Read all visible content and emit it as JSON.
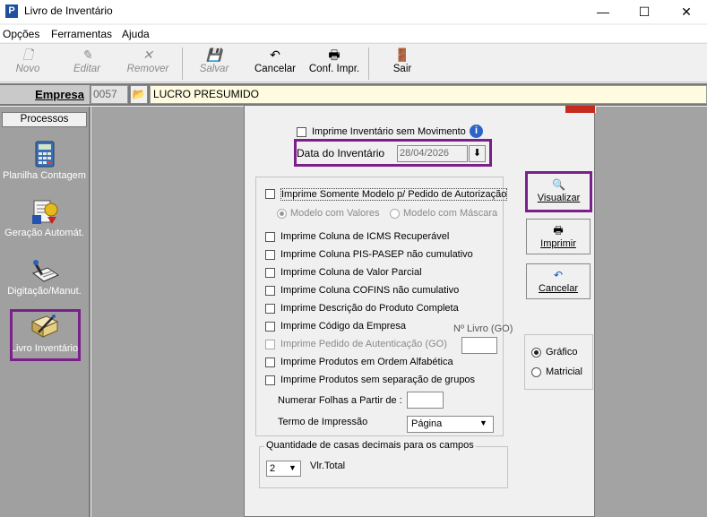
{
  "window": {
    "title": "Livro de Inventário",
    "icon_letter": "P",
    "controls": [
      "—",
      "☐",
      "✕"
    ]
  },
  "menu": [
    "Opções",
    "Ferramentas",
    "Ajuda"
  ],
  "toolbar": {
    "novo": "Novo",
    "editar": "Editar",
    "remover": "Remover",
    "salvar": "Salvar",
    "cancelar": "Cancelar",
    "conf_impr": "Conf. Impr.",
    "sair": "Sair"
  },
  "empresa": {
    "label": "Empresa",
    "code": "0057",
    "name": "LUCRO PRESUMIDO"
  },
  "sidebar": {
    "header": "Processos",
    "items": [
      {
        "label": "Planilha Contagem",
        "icon": "calculator-icon"
      },
      {
        "label": "Geração Automát.",
        "icon": "automation-icon"
      },
      {
        "label": "Digitação/Manut.",
        "icon": "typing-icon"
      },
      {
        "label": "Livro Inventário",
        "icon": "book-icon"
      }
    ]
  },
  "dialog": {
    "sem_movimento": "Imprime Inventário sem Movimento",
    "data_label": "Data do Inventário",
    "data_value": "28/04/2026",
    "modelo_pedido": "Imprime Somente Modelo p/ Pedido de Autorização",
    "modelo_valores": "Modelo com Valores",
    "modelo_mascara": "Modelo com Máscara",
    "options": [
      "Imprime Coluna de ICMS Recuperável",
      "Imprime Coluna PIS-PASEP não cumulativo",
      "Imprime Coluna de Valor Parcial",
      "Imprime Coluna COFINS não cumulativo",
      "Imprime Descrição do Produto Completa",
      "Imprime Código da Empresa",
      "Imprime Pedido de Autenticação (GO)",
      "Imprime Produtos em Ordem Alfabética",
      "Imprime Produtos sem separação de grupos"
    ],
    "livro_go_label": "Nº Livro (GO)",
    "livro_go_value": "",
    "numerar_label": "Numerar Folhas a Partir de :",
    "numerar_value": "",
    "termo_label": "Termo de Impressão",
    "termo_value": "Página",
    "casas_label": "Quantidade de casas decimais para os campos",
    "casas_value": "2",
    "vlr_total": "Vlr.Total",
    "btn_visualizar": "Visualizar",
    "btn_imprimir": "Imprimir",
    "btn_cancelar": "Cancelar",
    "grafico": "Gráfico",
    "matricial": "Matricial"
  },
  "colors": {
    "highlight": "#7b1f8a",
    "sidebar_bg": "#a0a0a0",
    "empresa_name_bg": "#fffbe0"
  }
}
